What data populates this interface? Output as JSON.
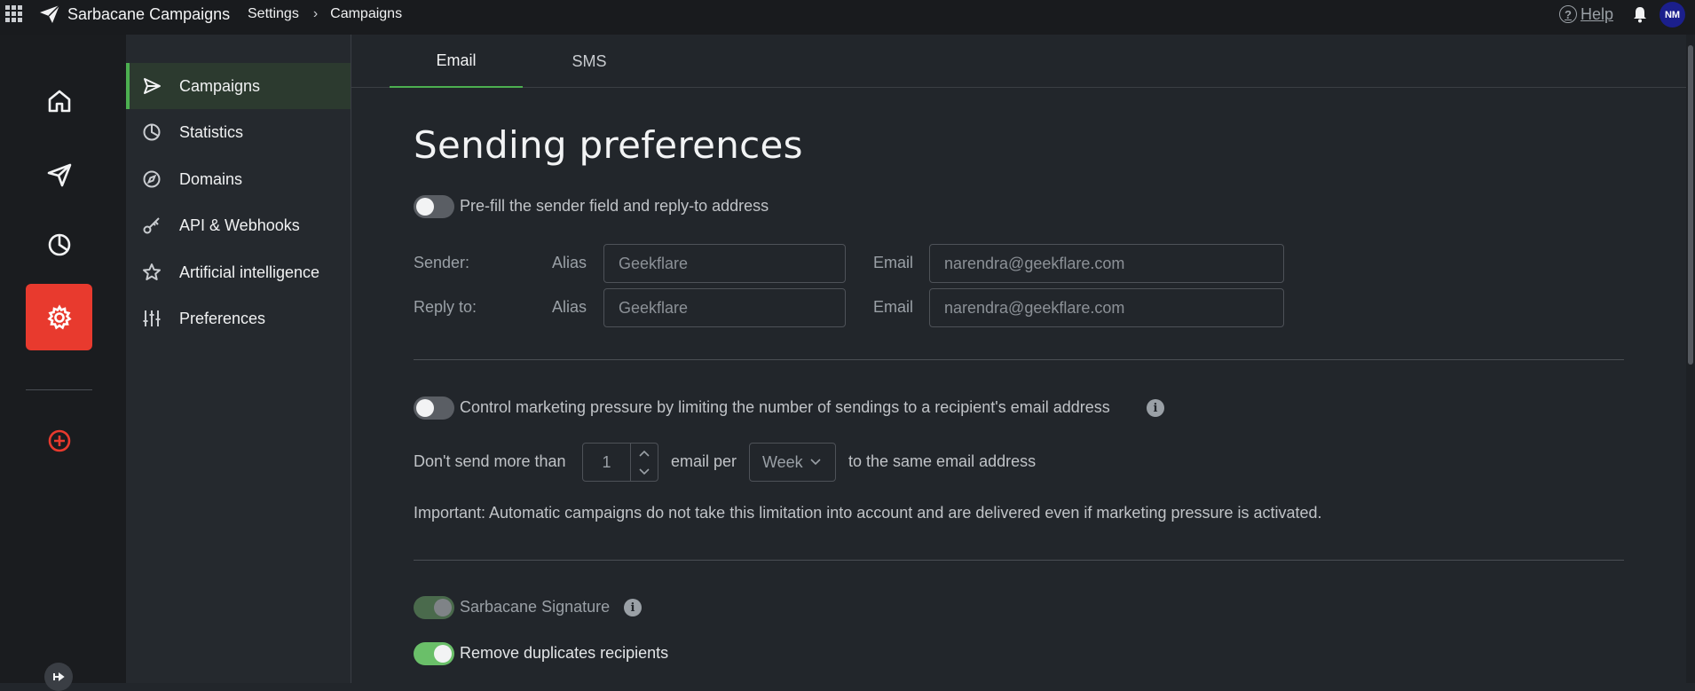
{
  "app": {
    "name": "Sarbacane Campaigns",
    "help_label": "Help",
    "help_glyph": "?",
    "user_initials": "NM"
  },
  "breadcrumb": [
    "Settings",
    "Campaigns"
  ],
  "breadcrumb_sep": "›",
  "subnav": {
    "items": [
      {
        "label": "Campaigns",
        "icon": "send-icon",
        "active": true
      },
      {
        "label": "Statistics",
        "icon": "pie-chart-icon"
      },
      {
        "label": "Domains",
        "icon": "compass-icon"
      },
      {
        "label": "API & Webhooks",
        "icon": "key-icon"
      },
      {
        "label": "Artificial intelligence",
        "icon": "star-icon"
      },
      {
        "label": "Preferences",
        "icon": "sliders-icon"
      }
    ]
  },
  "tabs": [
    {
      "label": "Email",
      "active": true
    },
    {
      "label": "SMS"
    }
  ],
  "page": {
    "title": "Sending preferences",
    "prefill_label": "Pre-fill the sender field and reply-to address",
    "sender_label": "Sender:",
    "replyto_label": "Reply to:",
    "alias_label": "Alias",
    "email_label": "Email",
    "sender_alias_placeholder": "Geekflare",
    "sender_email_placeholder": "narendra@geekflare.com",
    "replyto_alias_placeholder": "Geekflare",
    "replyto_email_placeholder": "narendra@geekflare.com",
    "pressure_label": "Control marketing pressure by limiting the number of sendings to a recipient's email address",
    "info_glyph": "i",
    "dont_send_label": "Don't send more than",
    "limit_value": "1",
    "email_per_label": "email per",
    "period_value": "Week",
    "same_address_label": "to the same email address",
    "important_note": "Important: Automatic campaigns do not take this limitation into account and are delivered even if marketing pressure is activated.",
    "signature_label": "Sarbacane Signature",
    "duplicates_label": "Remove duplicates recipients"
  },
  "toggles": {
    "prefill": false,
    "pressure": false,
    "signature": true,
    "duplicates": true
  },
  "colors": {
    "accent_green": "#4caf50",
    "active_red": "#e83a2e",
    "avatar_blue": "#1b1f8c"
  }
}
